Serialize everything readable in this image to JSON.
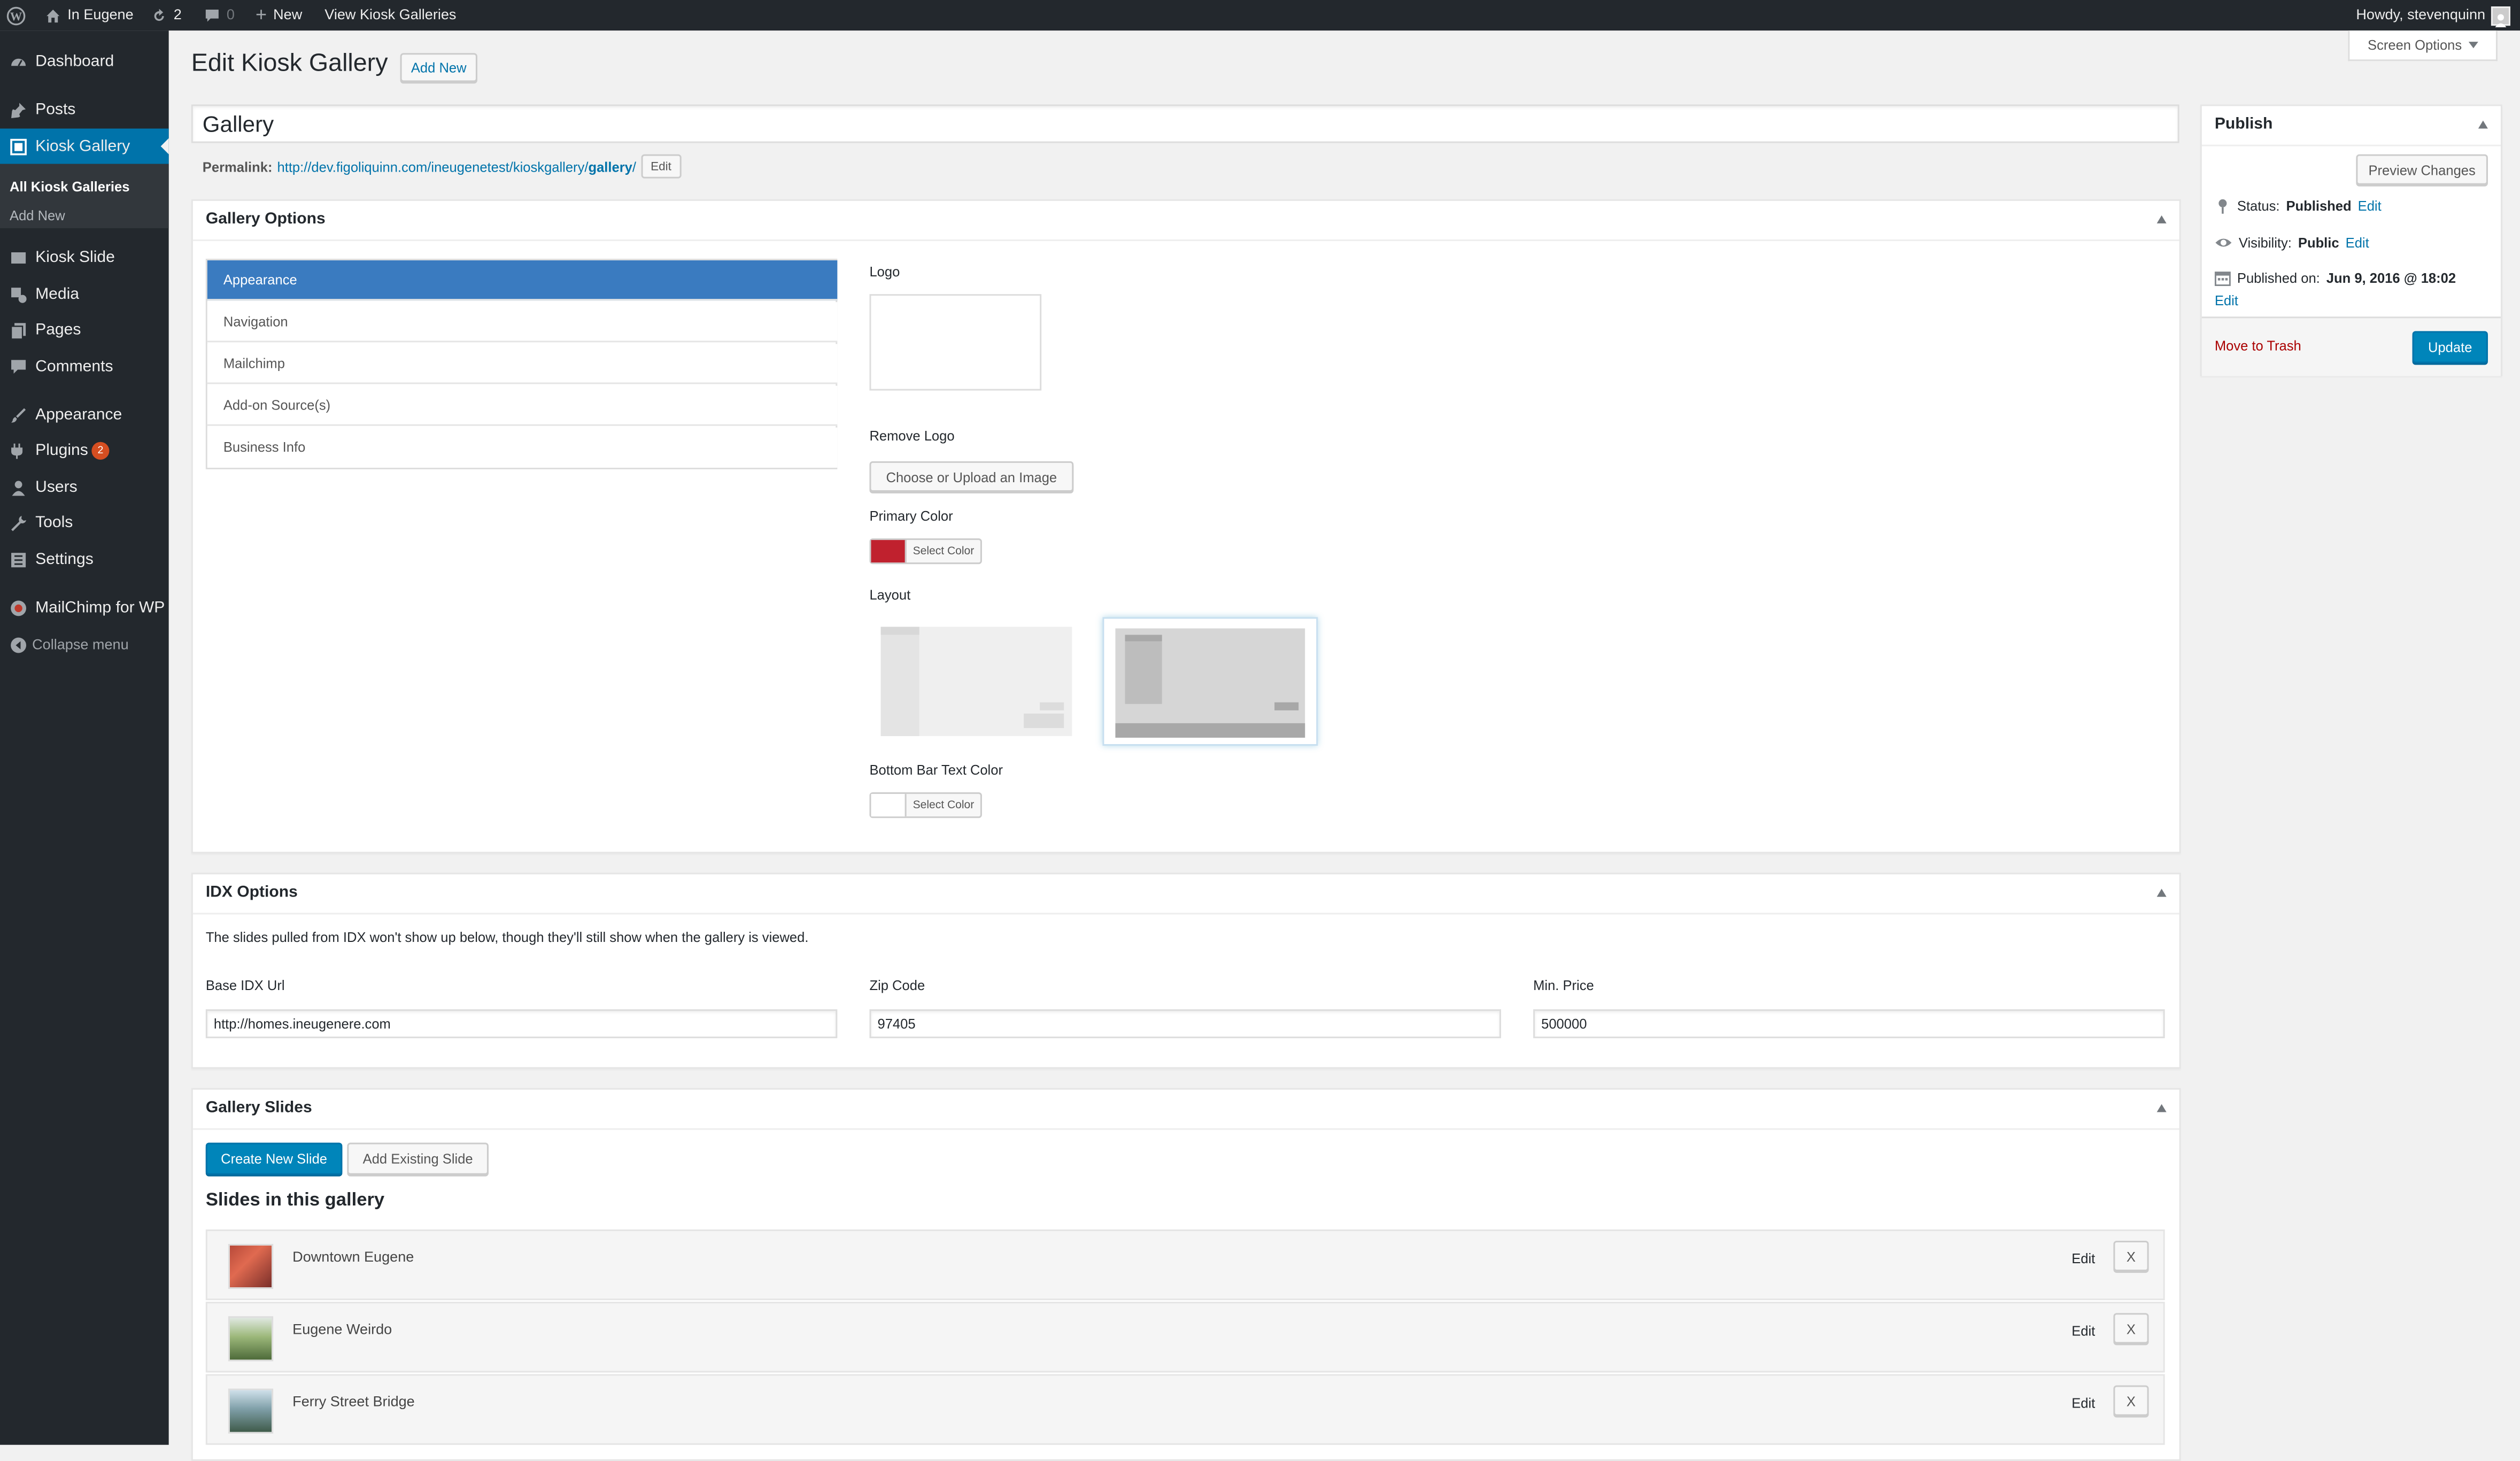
{
  "adminbar": {
    "site_name": "In Eugene",
    "updates_count": "2",
    "comments_count": "0",
    "new_label": "New",
    "view_label": "View Kiosk Galleries",
    "howdy": "Howdy, stevenquinn"
  },
  "sidebar": {
    "items": [
      {
        "label": "Dashboard"
      },
      {
        "label": "Posts"
      },
      {
        "label": "Kiosk Gallery"
      },
      {
        "label": "Kiosk Slide"
      },
      {
        "label": "Media"
      },
      {
        "label": "Pages"
      },
      {
        "label": "Comments"
      },
      {
        "label": "Appearance"
      },
      {
        "label": "Plugins"
      },
      {
        "label": "Users"
      },
      {
        "label": "Tools"
      },
      {
        "label": "Settings"
      },
      {
        "label": "MailChimp for WP"
      },
      {
        "label": "Collapse menu"
      }
    ],
    "submenu": [
      "All Kiosk Galleries",
      "Add New"
    ],
    "plugins_badge": "2"
  },
  "screen_options": "Screen Options",
  "page": {
    "title": "Edit Kiosk Gallery",
    "add_new": "Add New",
    "post_title": "Gallery",
    "permalink_label": "Permalink:",
    "permalink_base": "http://dev.figoliquinn.com/ineugenetest/kioskgallery/",
    "permalink_slug": "gallery",
    "permalink_trail": "/",
    "permalink_edit": "Edit"
  },
  "gallery_options": {
    "title": "Gallery Options",
    "tabs": [
      "Appearance",
      "Navigation",
      "Mailchimp",
      "Add-on Source(s)",
      "Business Info"
    ],
    "logo_label": "Logo",
    "remove_logo": "Remove Logo",
    "upload_button": "Choose or Upload an Image",
    "primary_color_label": "Primary Color",
    "primary_color": "#c0212e",
    "select_color": "Select Color",
    "layout_label": "Layout",
    "bottom_bar_label": "Bottom Bar Text Color",
    "bottom_bar_color": "#ffffff"
  },
  "idx_options": {
    "title": "IDX Options",
    "note": "The slides pulled from IDX won't show up below, though they'll still show when the gallery is viewed.",
    "base_url_label": "Base IDX Url",
    "base_url_value": "http://homes.ineugenere.com",
    "zip_label": "Zip Code",
    "zip_value": "97405",
    "min_price_label": "Min. Price",
    "min_price_value": "500000"
  },
  "gallery_slides": {
    "title": "Gallery Slides",
    "create_button": "Create New Slide",
    "add_existing_button": "Add Existing Slide",
    "heading": "Slides in this gallery",
    "edit_label": "Edit",
    "remove_label": "X",
    "slides": [
      {
        "name": "Downtown Eugene"
      },
      {
        "name": "Eugene Weirdo"
      },
      {
        "name": "Ferry Street Bridge"
      }
    ]
  },
  "publish": {
    "title": "Publish",
    "preview": "Preview Changes",
    "status_label": "Status:",
    "status_value": "Published",
    "visibility_label": "Visibility:",
    "visibility_value": "Public",
    "published_label": "Published on:",
    "published_value": "Jun 9, 2016 @ 18:02",
    "edit_label": "Edit",
    "trash": "Move to Trash",
    "update": "Update"
  },
  "colors": {
    "admin_dark": "#23282d",
    "accent_blue": "#0073aa",
    "primary_button": "#0085ba",
    "trash_red": "#a00"
  }
}
